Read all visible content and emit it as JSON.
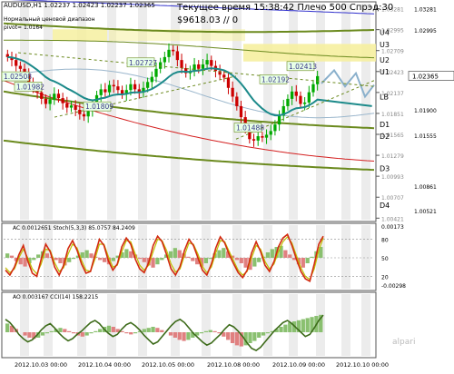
{
  "header": {
    "symbol_line": "AUDUSD,H1  1.02237 1.02423 1.02237 1.02365",
    "subtitle1": "Нормальный ценовой диапазон",
    "subtitle2": "pivot= 1.0164",
    "time_line": "Текущее время 15:38:42 Плечо 500 Спрэд:30",
    "balance_line": "$9618.03   // 0"
  },
  "chart_data": [
    {
      "type": "line",
      "title": "AUDUSD,H1",
      "y_axis_ticks": [
        "1.03281",
        "1.02995",
        "1.02709",
        "1.02423",
        "1.02137",
        "1.01851",
        "1.01565",
        "1.01279",
        "1.00993",
        "1.00707",
        "1.00421"
      ],
      "level_labels": [
        "U4",
        "U3",
        "U2",
        "U1",
        "LB",
        "D1",
        "D2",
        "D3",
        "D4"
      ],
      "price_labels": [
        "1.02508",
        "1.02727",
        "1.02413",
        "1.02192",
        "1.01982",
        "1.01809",
        "1.01488"
      ],
      "right_axis_values": [
        "1.03281",
        "1.02995",
        "1.02365",
        "1.01900",
        "1.01555",
        "1.00861",
        "1.00521"
      ],
      "current_price": "1.02365",
      "close_series": [
        1.0262,
        1.0258,
        1.025,
        1.0246,
        1.0238,
        1.0228,
        1.0219,
        1.0214,
        1.0205,
        1.0198,
        1.0204,
        1.0212,
        1.0206,
        1.0199,
        1.0193,
        1.0196,
        1.019,
        1.0184,
        1.0181,
        1.0188,
        1.0195,
        1.021,
        1.0218,
        1.0214,
        1.0224,
        1.0222,
        1.0217,
        1.0211,
        1.0217,
        1.0225,
        1.0218,
        1.0214,
        1.022,
        1.0228,
        1.0235,
        1.0246,
        1.0255,
        1.0262,
        1.0272,
        1.027,
        1.0258,
        1.0247,
        1.024,
        1.0243,
        1.0252,
        1.0246,
        1.0252,
        1.0258,
        1.025,
        1.0243,
        1.0238,
        1.0234,
        1.022,
        1.0208,
        1.0195,
        1.018,
        1.0165,
        1.015,
        1.0148,
        1.0154,
        1.0152,
        1.0156,
        1.0161,
        1.017,
        1.0182,
        1.0195,
        1.0205,
        1.0215,
        1.0209,
        1.0198,
        1.02,
        1.0214,
        1.0225,
        1.0236
      ]
    },
    {
      "type": "line",
      "title": "AC 0.0012651  Stoch(5,3,3) 85.0757 84.2409",
      "y_axis_ticks": [
        "0.00173",
        "80",
        "50",
        "20",
        "-0.00298"
      ],
      "stoch_main": [
        30,
        22,
        35,
        55,
        70,
        45,
        25,
        20,
        48,
        72,
        60,
        35,
        22,
        38,
        65,
        78,
        62,
        40,
        25,
        28,
        55,
        80,
        70,
        45,
        30,
        40,
        68,
        82,
        72,
        48,
        32,
        26,
        42,
        70,
        85,
        76,
        55,
        32,
        22,
        36,
        62,
        80,
        70,
        50,
        30,
        22,
        40,
        66,
        84,
        74,
        55,
        40,
        26,
        18,
        30,
        58,
        76,
        60,
        38,
        28,
        44,
        68,
        82,
        88,
        70,
        48,
        28,
        16,
        12,
        40,
        72,
        85
      ],
      "stoch_signal": [
        34,
        26,
        32,
        50,
        64,
        50,
        32,
        24,
        40,
        64,
        62,
        42,
        28,
        34,
        56,
        72,
        66,
        46,
        30,
        28,
        48,
        72,
        72,
        52,
        35,
        38,
        60,
        78,
        76,
        56,
        38,
        30,
        38,
        60,
        80,
        78,
        62,
        40,
        27,
        32,
        54,
        74,
        72,
        56,
        36,
        26,
        35,
        58,
        78,
        76,
        60,
        45,
        30,
        22,
        28,
        50,
        70,
        64,
        44,
        32,
        40,
        60,
        76,
        84,
        74,
        54,
        34,
        20,
        15,
        32,
        62,
        82
      ],
      "ac_histogram": [
        0.4,
        0.2,
        -0.3,
        -0.6,
        -0.8,
        -0.5,
        -0.2,
        0.3,
        0.6,
        0.4,
        0.1,
        -0.2,
        -0.5,
        -0.7,
        -0.4,
        -0.1,
        0.2,
        0.5,
        0.7,
        0.4,
        0.1,
        -0.2,
        -0.4,
        -0.6,
        -0.3,
        0.2,
        0.5,
        0.8,
        0.6,
        0.3,
        -0.1,
        -0.4,
        -0.7,
        -0.9,
        -0.6,
        -0.2,
        0.3,
        0.6,
        0.9,
        0.7,
        0.4,
        0.1,
        -0.3,
        -0.6,
        -0.8,
        -0.5,
        -0.1,
        0.4,
        0.7,
        0.9,
        0.6,
        0.2,
        -0.2,
        -0.5,
        -0.9,
        -1.1,
        -0.8,
        -0.4,
        0.1,
        0.5,
        0.8,
        1.0,
        1.1,
        0.7,
        0.3,
        -0.2,
        -0.6,
        -0.9,
        -0.5,
        0.1,
        0.6,
        1.0
      ]
    },
    {
      "type": "bar",
      "title": "AO 0.003167  CCI(14) 158.2215",
      "cci": [
        120,
        90,
        40,
        -20,
        -60,
        -90,
        -70,
        -30,
        20,
        60,
        80,
        40,
        -10,
        -50,
        -80,
        -60,
        -20,
        10,
        50,
        90,
        110,
        80,
        30,
        -10,
        -40,
        -20,
        30,
        70,
        90,
        60,
        20,
        -30,
        -70,
        -110,
        -90,
        -40,
        10,
        60,
        100,
        120,
        90,
        40,
        -10,
        -50,
        -90,
        -120,
        -100,
        -60,
        -20,
        30,
        70,
        50,
        10,
        -40,
        -100,
        -150,
        -170,
        -140,
        -90,
        -40,
        10,
        50,
        90,
        110,
        80,
        40,
        0,
        -40,
        -20,
        40,
        110,
        160
      ],
      "ao_histogram": [
        0.8,
        0.6,
        0.3,
        0.0,
        -0.3,
        -0.5,
        -0.6,
        -0.5,
        -0.3,
        -0.1,
        0.1,
        0.3,
        0.4,
        0.3,
        0.1,
        -0.1,
        -0.3,
        -0.4,
        -0.3,
        -0.1,
        0.1,
        0.3,
        0.5,
        0.6,
        0.5,
        0.3,
        0.1,
        -0.1,
        -0.2,
        -0.1,
        0.1,
        0.3,
        0.4,
        0.5,
        0.4,
        0.2,
        0.0,
        -0.3,
        -0.5,
        -0.7,
        -0.8,
        -0.7,
        -0.5,
        -0.3,
        -0.1,
        0.1,
        0.2,
        0.1,
        -0.1,
        -0.4,
        -0.7,
        -1.0,
        -1.2,
        -1.3,
        -1.2,
        -1.0,
        -0.8,
        -0.5,
        -0.3,
        -0.1,
        0.1,
        0.3,
        0.5,
        0.7,
        0.9,
        1.0,
        1.1,
        1.2,
        1.3,
        1.4,
        1.5,
        1.6
      ]
    }
  ],
  "x_axis_labels": [
    "2012.10.03 00:00",
    "2012.10.04 00:00",
    "2012.10.05 00:00",
    "2012.10.08 00:00",
    "2012.10.09 00:00",
    "2012.10.10 00:00"
  ],
  "brand": "alpari",
  "colors": {
    "candle_up": "#00aa00",
    "candle_down": "#cc0000",
    "ema_teal": "#1c8a8a",
    "band_olive": "#6b8a1e",
    "band_blue": "#3030cc",
    "band_red": "#d42020",
    "zone_yellow": "#f6f0a0",
    "stoch_main": "#d22a10",
    "stoch_signal": "#c0c000",
    "cci": "#3d6b1a"
  }
}
